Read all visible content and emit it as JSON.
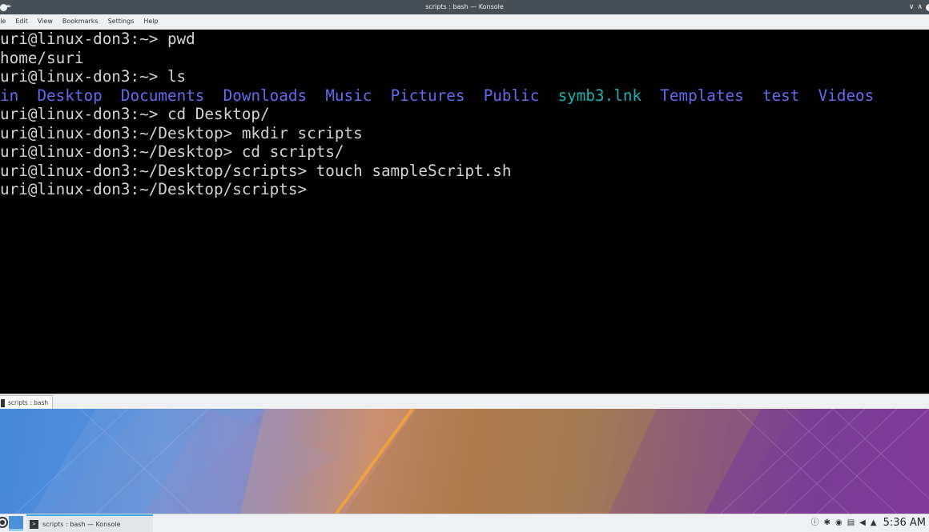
{
  "window": {
    "title": "scripts : bash — Konsole"
  },
  "menu": {
    "items": [
      "ile",
      "Edit",
      "View",
      "Bookmarks",
      "Settings",
      "Help"
    ]
  },
  "terminal": {
    "lines": [
      "uri@linux-don3:~> pwd",
      "home/suri",
      "uri@linux-don3:~> ls",
      "",
      "uri@linux-don3:~> cd Desktop/",
      "uri@linux-don3:~/Desktop> mkdir scripts",
      "uri@linux-don3:~/Desktop> cd scripts/",
      "uri@linux-don3:~/Desktop/scripts> touch sampleScript.sh",
      "uri@linux-don3:~/Desktop/scripts> "
    ],
    "ls_output": [
      {
        "name": "in",
        "kind": "dir"
      },
      {
        "name": "Desktop",
        "kind": "dir"
      },
      {
        "name": "Documents",
        "kind": "dir"
      },
      {
        "name": "Downloads",
        "kind": "dir"
      },
      {
        "name": "Music",
        "kind": "dir"
      },
      {
        "name": "Pictures",
        "kind": "dir"
      },
      {
        "name": "Public",
        "kind": "dir"
      },
      {
        "name": "symb3.lnk",
        "kind": "link"
      },
      {
        "name": "Templates",
        "kind": "dir"
      },
      {
        "name": "test",
        "kind": "dir"
      },
      {
        "name": "Videos",
        "kind": "dir"
      }
    ],
    "colors": {
      "background": "#000000",
      "foreground": "#d3d3d3",
      "directory": "#5f6cf0",
      "symlink": "#19b2b2"
    }
  },
  "tabs": {
    "active_label": "scripts : bash"
  },
  "taskbar": {
    "task_label": "scripts : bash — Konsole",
    "clock": "5:36 AM",
    "tray_icons": [
      "info-icon",
      "bluetooth-icon",
      "network-icon",
      "clipboard-icon",
      "volume-icon",
      "expand-tray-icon"
    ]
  }
}
